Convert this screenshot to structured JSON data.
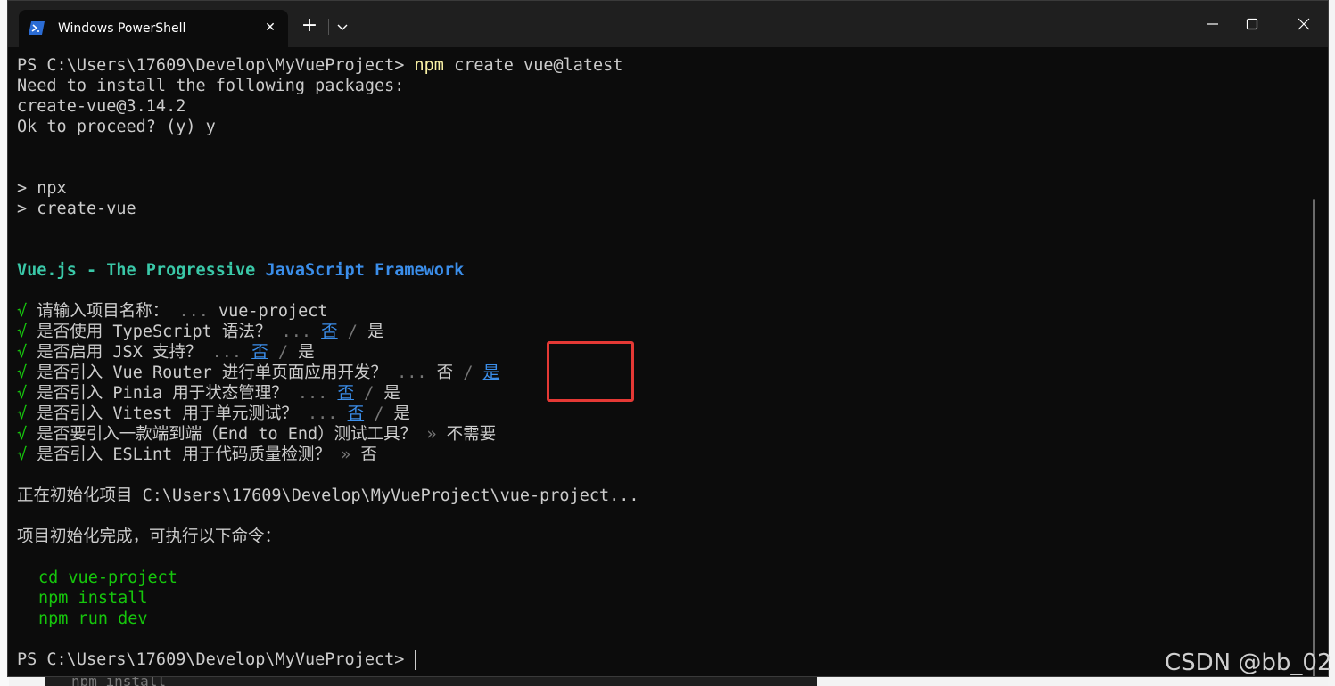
{
  "window": {
    "tab_title": "Windows PowerShell",
    "tab_close": "✕",
    "new_tab": "+",
    "icons": [
      "powershell-icon",
      "close-icon",
      "plus-icon",
      "chevron-down-icon",
      "minimize-icon",
      "maximize-icon",
      "window-close-icon"
    ]
  },
  "terminal": {
    "l1_prompt": "PS C:\\Users\\17609\\Develop\\MyVueProject> ",
    "l1_cmd": "npm",
    "l1_args": " create vue@latest",
    "l2": "Need to install the following packages:",
    "l3": "create-vue@3.14.2",
    "l4": "Ok to proceed? (y) y",
    "l5": "> npx",
    "l6": "> create-vue",
    "banner_a": "Vue.js - The ",
    "banner_b": "Progressive ",
    "banner_c": "JavaScript ",
    "banner_d": "Framework",
    "check": "√",
    "ellipsis": "...",
    "slash": "/",
    "arrow": "»",
    "q1": "请输入项目名称：",
    "a1": "vue-project",
    "q2": "是否使用 TypeScript 语法？",
    "q3": "是否启用 JSX 支持？",
    "q4": "是否引入 Vue Router 进行单页面应用开发？",
    "q5": "是否引入 Pinia 用于状态管理？",
    "q6": "是否引入 Vitest 用于单元测试？",
    "q7": "是否要引入一款端到端（End to End）测试工具？",
    "a7": "不需要",
    "q8": "是否引入 ESLint 用于代码质量检测？",
    "yes": "是",
    "no": "否",
    "init": "正在初始化项目 C:\\Users\\17609\\Develop\\MyVueProject\\vue-project...",
    "done": "项目初始化完成，可执行以下命令：",
    "cmd1": "cd vue-project",
    "cmd2": "npm install",
    "cmd3": "npm run dev",
    "final_prompt": "PS C:\\Users\\17609\\Develop\\MyVueProject> "
  },
  "desktop": {
    "behind_text": "npm install"
  },
  "watermark": "CSDN @bb_02",
  "colors": {
    "terminal_bg": "#0c0c0c",
    "text": "#cccccc",
    "green": "#16c60c",
    "cyan": "#3ac8a8",
    "blue": "#3b8eea",
    "yellow": "#f9f1a5",
    "highlight_box": "#e53935"
  }
}
